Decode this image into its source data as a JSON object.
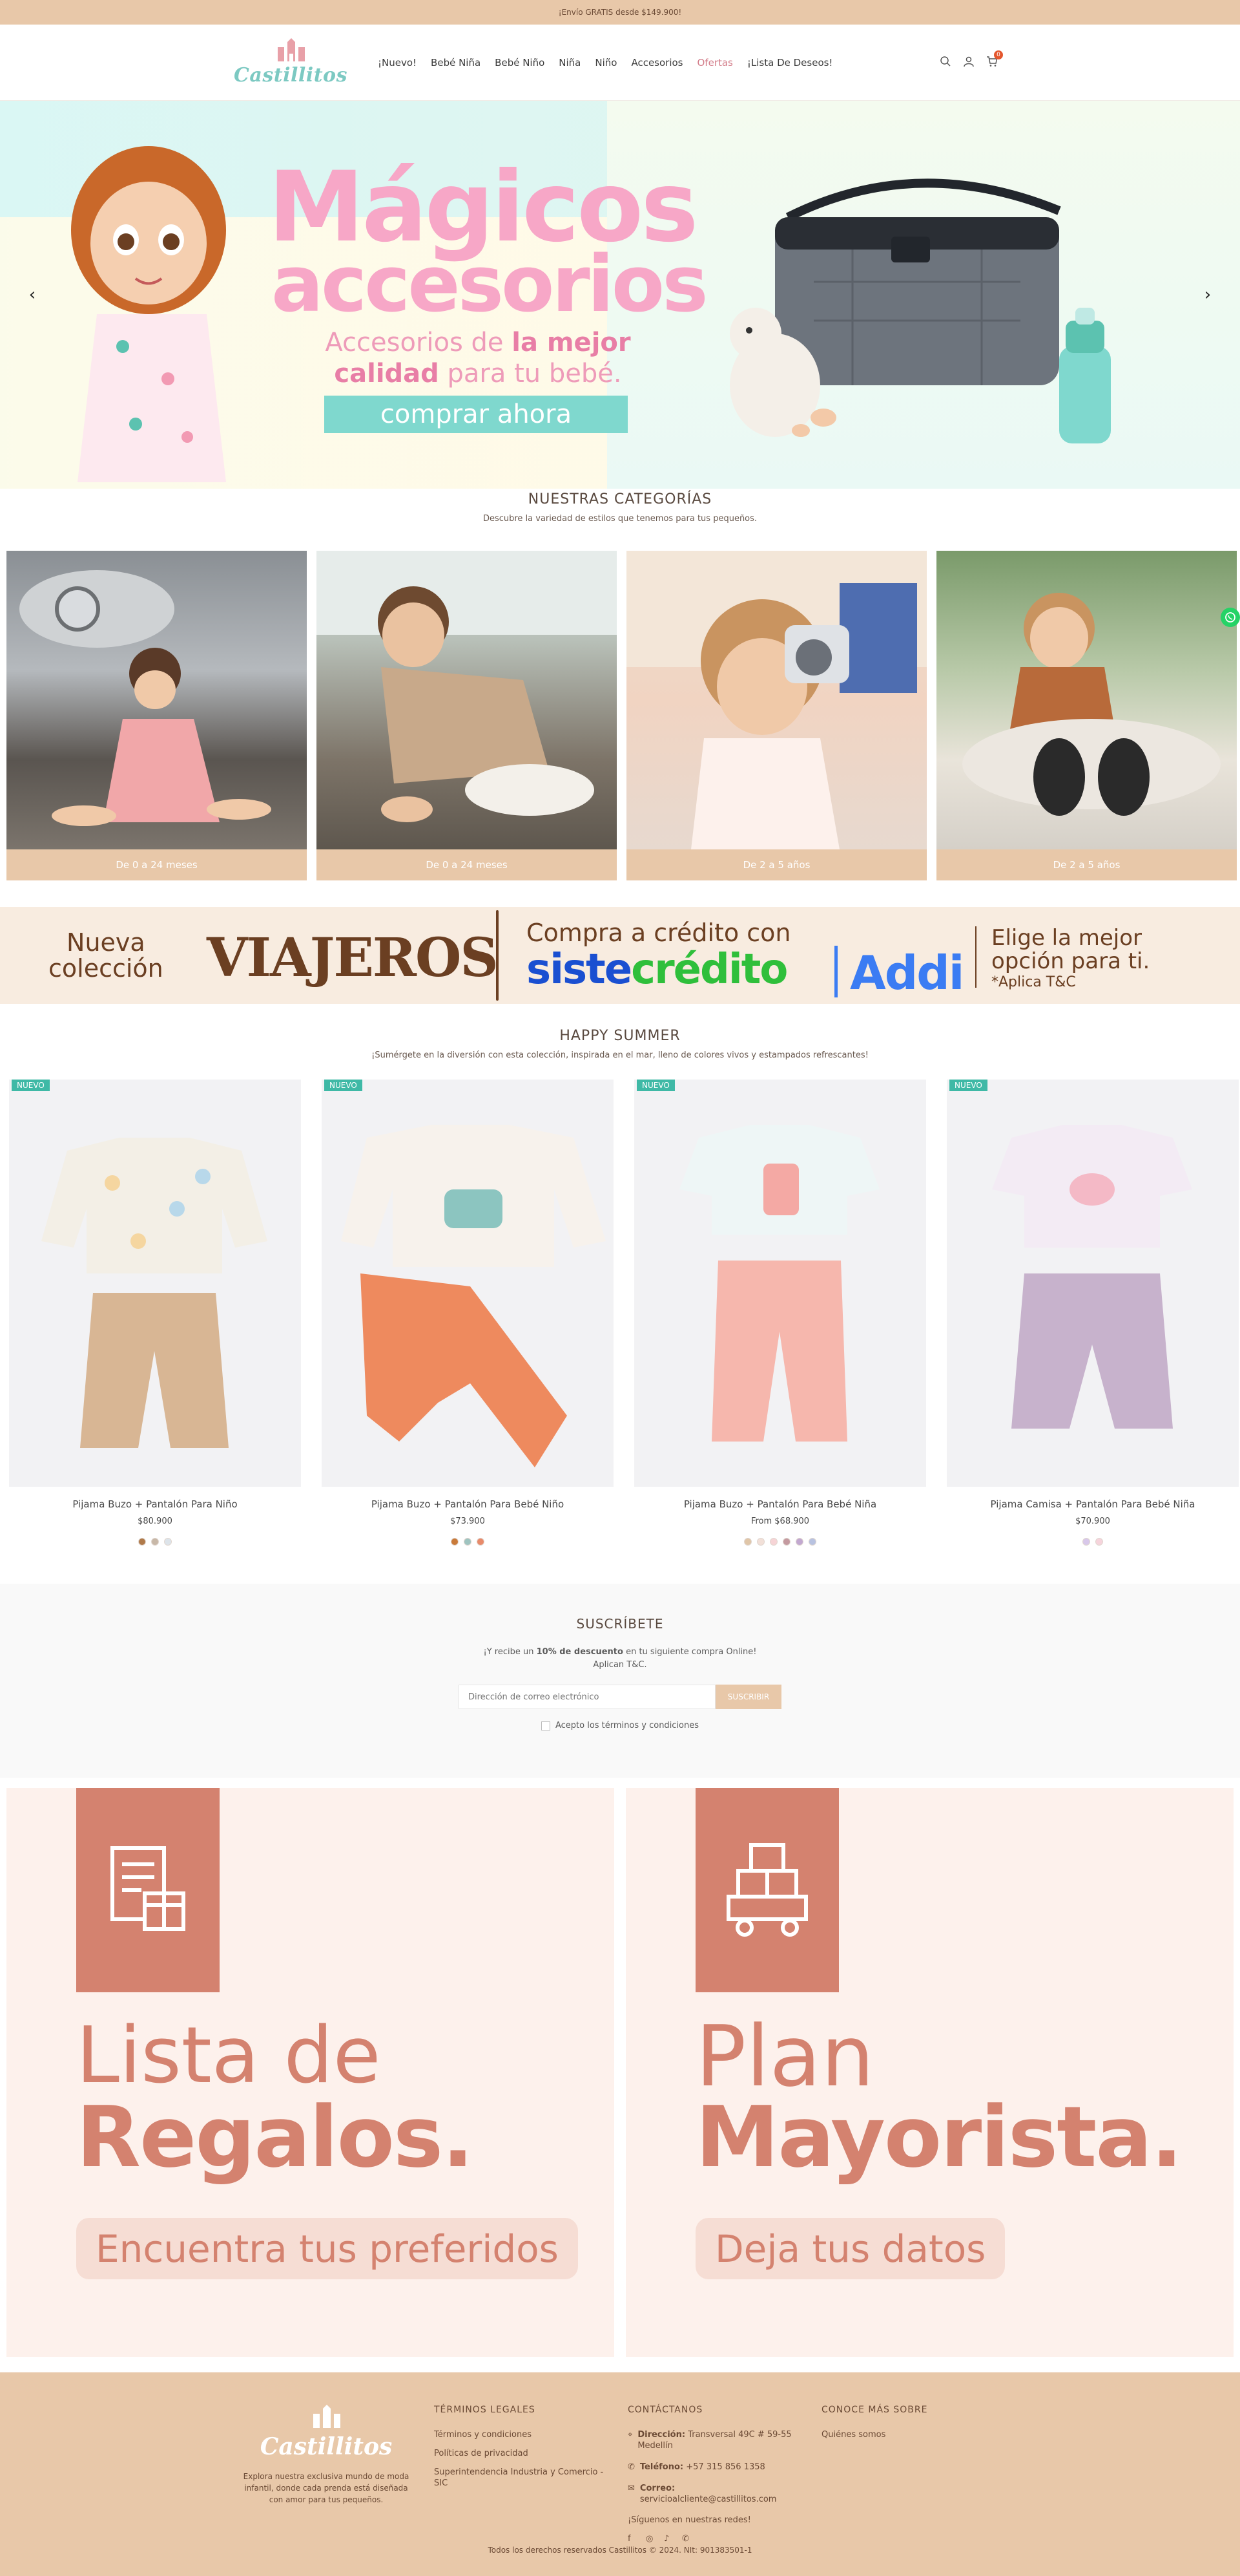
{
  "announcement": "¡Envío GRATIS desde $149.900!",
  "header": {
    "logo_text": "Castillitos",
    "nav": [
      "¡Nuevo!",
      "Bebé Niña",
      "Bebé Niño",
      "Niña",
      "Niño",
      "Accesorios",
      "Ofertas",
      "¡Lista De Deseos!"
    ],
    "cart_count": "0"
  },
  "hero": {
    "title_line1": "Mágicos",
    "title_line2": "accesorios",
    "subtitle_part1": "Accesorios de ",
    "subtitle_bold1": "la mejor",
    "subtitle_bold2": "calidad",
    "subtitle_part2": " para tu bebé.",
    "cta": "comprar ahora"
  },
  "categories": {
    "title": "NUESTRAS CATEGORÍAS",
    "subtitle": "Descubre la variedad de estilos que tenemos para tus pequeños.",
    "items": [
      {
        "label": "De 0 a 24 meses"
      },
      {
        "label": "De 0 a 24 meses"
      },
      {
        "label": "De 2 a 5 años"
      },
      {
        "label": "De 2 a 5 años"
      }
    ]
  },
  "promo": {
    "nueva": "Nueva",
    "coleccion": "colección",
    "viajeros": "VIAJEROS",
    "compra": "Compra a crédito con",
    "siste": "siste",
    "credito": "crédito",
    "addi": "Addi",
    "elige1": "Elige la mejor",
    "elige2": "opción para ti.",
    "aplica": "*Aplica T&C"
  },
  "products": {
    "title": "HAPPY SUMMER",
    "subtitle": "¡Sumérgete en la diversión con esta colección, inspirada en el mar, lleno de colores vivos y estampados refrescantes!",
    "badge": "NUEVO",
    "items": [
      {
        "name": "Pijama Buzo + Pantalón Para Niño",
        "price": "$80.900",
        "swatches": [
          "#b07a4a",
          "#c8b8a8",
          "#dde4ea"
        ]
      },
      {
        "name": "Pijama Buzo + Pantalón Para Bebé Niño",
        "price": "$73.900",
        "swatches": [
          "#c97a3a",
          "#9fc4c0",
          "#e88a6a"
        ]
      },
      {
        "name": "Pijama Buzo + Pantalón Para Bebé Niña",
        "price": "From $68.900",
        "swatches": [
          "#e0c6a8",
          "#f2e0d8",
          "#f6d4d6",
          "#c49aa0",
          "#c2a8d0",
          "#b8c2e0"
        ]
      },
      {
        "name": "Pijama Camisa + Pantalón Para Bebé Niña",
        "price": "$70.900",
        "swatches": [
          "#d8c8ea",
          "#f6d4dc"
        ]
      }
    ]
  },
  "subscribe": {
    "title": "SUSCRÍBETE",
    "text_pre": "¡Y recibe un ",
    "text_bold": "10% de descuento",
    "text_post": " en tu siguiente compra Online!",
    "text_line2": "Aplican T&C.",
    "placeholder": "Dirección de correo electrónico",
    "button": "SUSCRIBIR",
    "terms": "Acepto los términos y condiciones"
  },
  "tiles": [
    {
      "line1": "Lista de",
      "line2": "Regalos.",
      "cta": "Encuentra tus preferidos"
    },
    {
      "line1": "Plan",
      "line2": "Mayorista.",
      "cta": "Deja tus datos"
    }
  ],
  "footer": {
    "logo_text": "Castillitos",
    "description": "Explora nuestra exclusiva mundo de moda infantil, donde cada prenda está diseñada con amor para tus pequeños.",
    "legal_title": "TÉRMINOS LEGALES",
    "legal_links": [
      "Términos y condiciones",
      "Políticas de privacidad",
      "Superintendencia Industria y Comercio - SIC"
    ],
    "contact_title": "CONTÁCTANOS",
    "address_label": "Dirección:",
    "address": "Transversal 49C # 59-55 Medellín",
    "phone_label": "Teléfono:",
    "phone": "+57 315 856 1358",
    "email_label": "Correo:",
    "email": "servicioalcliente@castillitos.com",
    "follow": "¡Síguenos en nuestras redes!",
    "more_title": "CONOCE MÁS SOBRE",
    "more_links": [
      "Quiénes somos"
    ],
    "copyright": "Todos los derechos reservados Castillitos © 2024. NIt: 901383501-1"
  }
}
